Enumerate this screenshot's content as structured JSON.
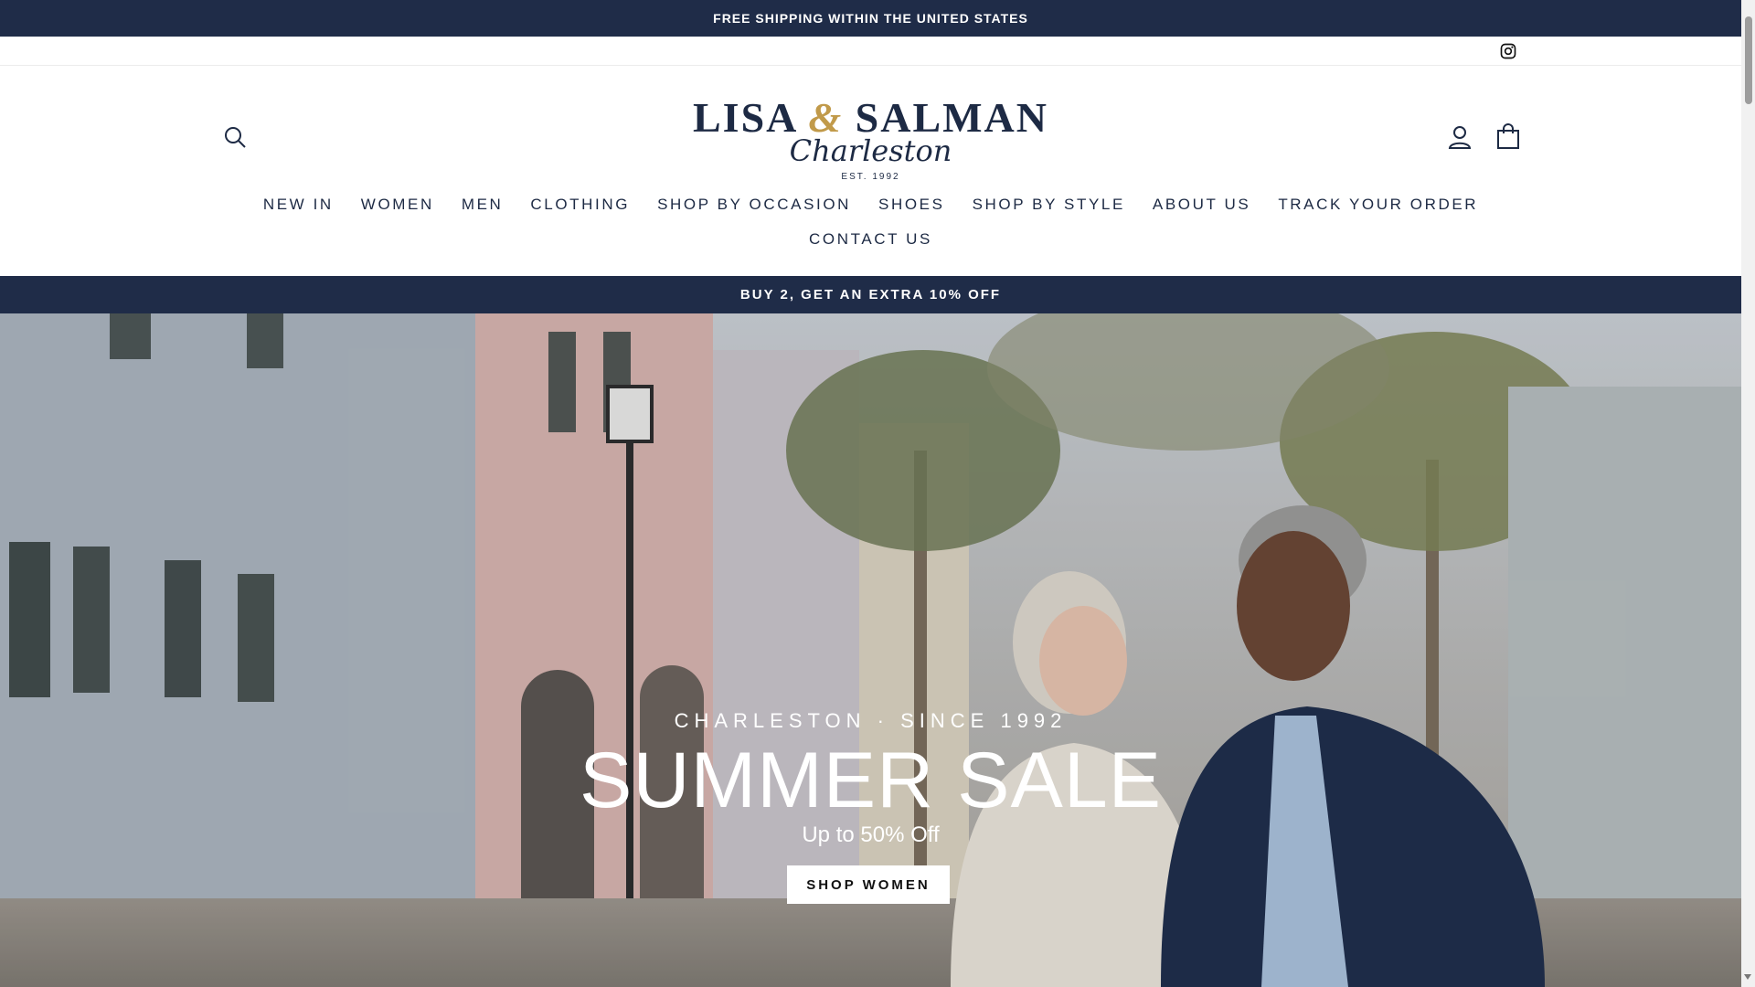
{
  "announcement": {
    "text": "FREE SHIPPING WITHIN THE UNITED STATES"
  },
  "utility": {
    "instagram_icon": "instagram-icon"
  },
  "header": {
    "search_icon": "search-icon",
    "account_icon": "user-icon",
    "cart_icon": "shopping-bag-icon",
    "logo": {
      "part1": "LISA",
      "amp": "&",
      "part2": "SALMAN",
      "script": "Charleston",
      "est": "EST. 1992"
    }
  },
  "nav": {
    "row1": [
      {
        "label": "NEW IN"
      },
      {
        "label": "WOMEN"
      },
      {
        "label": "MEN"
      },
      {
        "label": "CLOTHING"
      },
      {
        "label": "SHOP BY OCCASION"
      },
      {
        "label": "SHOES"
      },
      {
        "label": "SHOP BY STYLE"
      },
      {
        "label": "ABOUT US"
      },
      {
        "label": "TRACK YOUR ORDER"
      }
    ],
    "row2": [
      {
        "label": "CONTACT US"
      }
    ]
  },
  "promo": {
    "text": "BUY 2, GET AN EXTRA 10% OFF"
  },
  "hero": {
    "eyebrow": "CHARLESTON · SINCE 1992",
    "title": "SUMMER SALE",
    "subtitle": "Up to 50% Off",
    "cta": "SHOP WOMEN"
  },
  "colors": {
    "navy": "#1f2c48",
    "gold": "#c19a4a",
    "white": "#ffffff"
  }
}
